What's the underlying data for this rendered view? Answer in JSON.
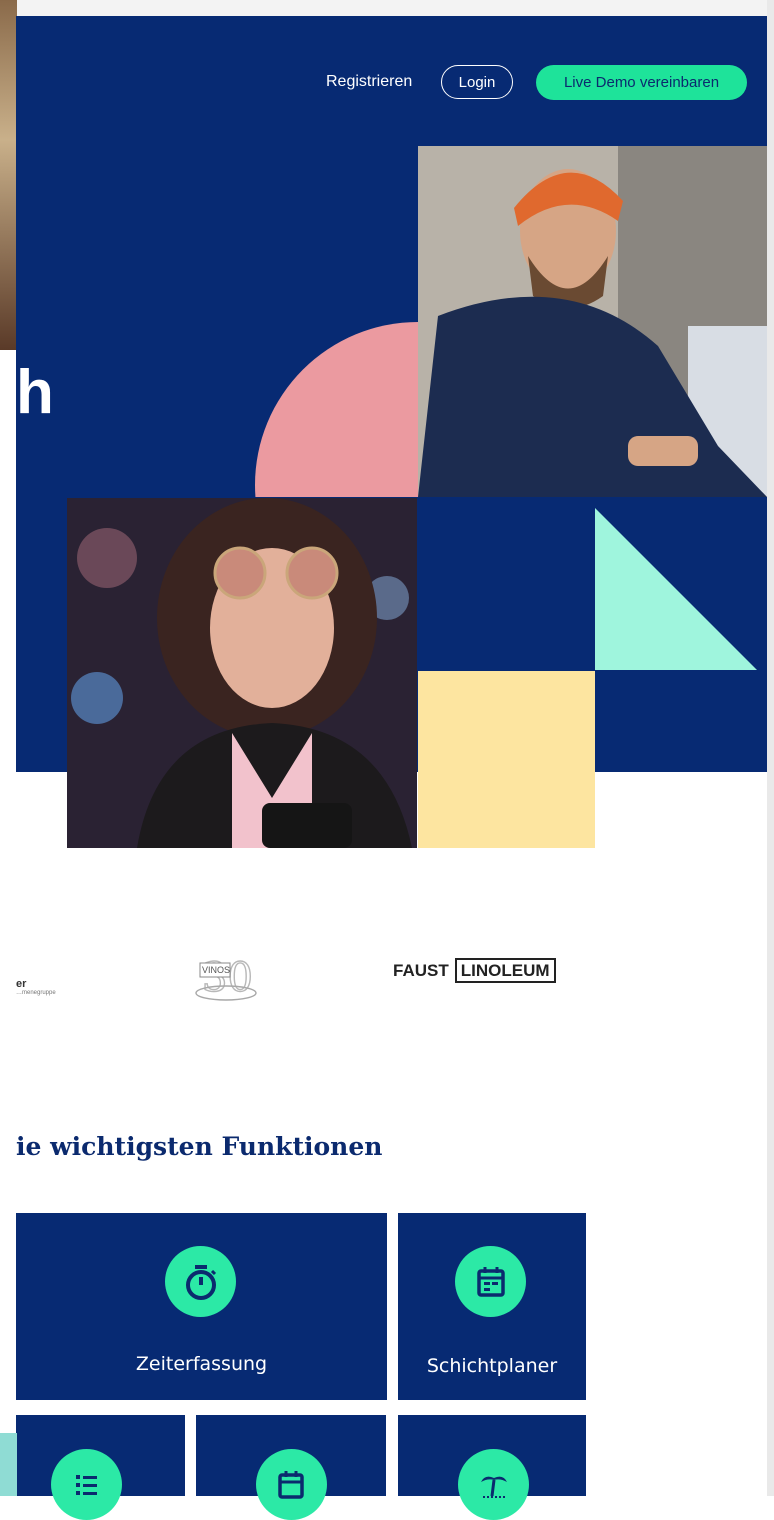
{
  "nav": {
    "register": "Registrieren",
    "login": "Login",
    "demo": "Live Demo vereinbaren"
  },
  "hero": {
    "partial_heading": "h"
  },
  "logos": {
    "left_partial": "er",
    "left_partial_sub": "…menegruppe",
    "vinos": "VINOS",
    "faust": "FAUST",
    "linoleum": "LINOLEUM"
  },
  "features": {
    "title": "ie wichtigsten Funktionen",
    "tiles": [
      {
        "label": "Zeiterfassung",
        "icon": "stopwatch-icon"
      },
      {
        "label": "Schichtplaner",
        "icon": "calendar-icon"
      },
      {
        "label": "",
        "icon": "list-icon"
      },
      {
        "label": "",
        "icon": "calendar-edit-icon"
      },
      {
        "label": "",
        "icon": "palm-tree-icon"
      }
    ]
  },
  "colors": {
    "navy": "#072a73",
    "mint": "#1ee39a",
    "pink": "#eb9aa0",
    "yellow": "#fde5a0",
    "light_mint": "#9ff5dd"
  }
}
